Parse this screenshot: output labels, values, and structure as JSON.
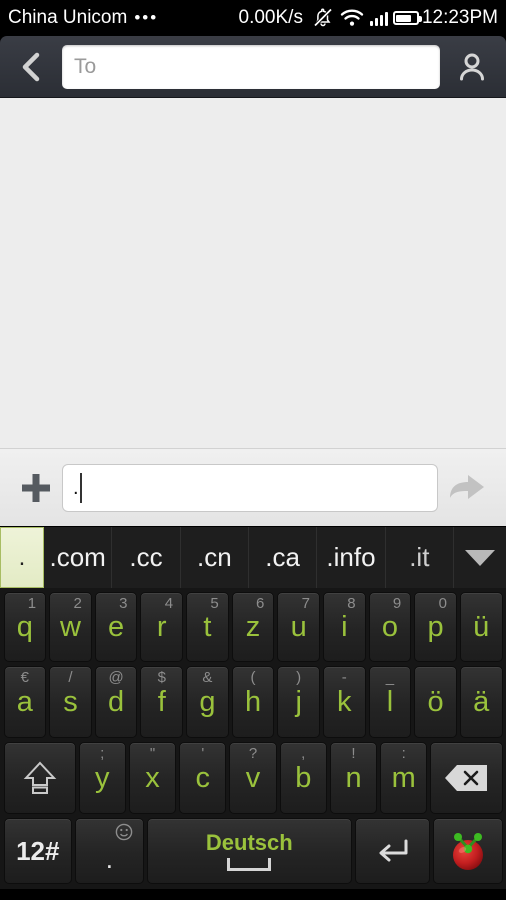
{
  "statusbar": {
    "carrier": "China Unicom",
    "dots": "•••",
    "network_speed": "0.00K/s",
    "mute_icon": "bell-muted-icon",
    "wifi_icon": "wifi-icon",
    "signal_icon": "signal-bars-icon",
    "battery_icon": "battery-icon",
    "time": "12:23PM"
  },
  "navbar": {
    "back_icon": "back-chevron-icon",
    "to_placeholder": "To",
    "to_value": "",
    "contact_icon": "person-icon"
  },
  "compose": {
    "add_icon": "plus-icon",
    "message_value": ".",
    "message_placeholder": "",
    "send_icon": "send-arrow-icon"
  },
  "suggestions": {
    "selected": ".",
    "items": [
      ".com",
      ".cc",
      ".cn",
      ".ca",
      ".info",
      ".it"
    ],
    "more_icon": "chevron-down-icon"
  },
  "keyboard": {
    "language": "Deutsch",
    "row1": [
      {
        "main": "q",
        "sub": "1"
      },
      {
        "main": "w",
        "sub": "2"
      },
      {
        "main": "e",
        "sub": "3"
      },
      {
        "main": "r",
        "sub": "4"
      },
      {
        "main": "t",
        "sub": "5"
      },
      {
        "main": "z",
        "sub": "6"
      },
      {
        "main": "u",
        "sub": "7"
      },
      {
        "main": "i",
        "sub": "8"
      },
      {
        "main": "o",
        "sub": "9"
      },
      {
        "main": "p",
        "sub": "0"
      },
      {
        "main": "ü",
        "sub": ""
      }
    ],
    "row2": [
      {
        "main": "a",
        "sub": "€"
      },
      {
        "main": "s",
        "sub": "/"
      },
      {
        "main": "d",
        "sub": "@"
      },
      {
        "main": "f",
        "sub": "$"
      },
      {
        "main": "g",
        "sub": "&"
      },
      {
        "main": "h",
        "sub": "("
      },
      {
        "main": "j",
        "sub": ")"
      },
      {
        "main": "k",
        "sub": "-"
      },
      {
        "main": "l",
        "sub": "_"
      },
      {
        "main": "ö",
        "sub": ""
      },
      {
        "main": "ä",
        "sub": ""
      }
    ],
    "row3": [
      {
        "main": "y",
        "sub": ";"
      },
      {
        "main": "x",
        "sub": "\""
      },
      {
        "main": "c",
        "sub": "'"
      },
      {
        "main": "v",
        "sub": "?"
      },
      {
        "main": "b",
        "sub": ","
      },
      {
        "main": "n",
        "sub": "!"
      },
      {
        "main": "m",
        "sub": ":"
      }
    ],
    "shift_icon": "shift-icon",
    "backspace_icon": "backspace-icon",
    "numeric_label": "12#",
    "period_label": ".",
    "emoji_icon": "smiley-icon",
    "space_icon": "spacebar-icon",
    "enter_icon": "enter-icon",
    "ime_icon": "tomato-ime-icon"
  },
  "colors": {
    "key_text_green": "#9ac23c",
    "keyboard_bg": "#161616",
    "navbar_bg": "#33363d",
    "body_bg": "#ededed",
    "suggestion_selected_bg": "#e8efd0"
  }
}
